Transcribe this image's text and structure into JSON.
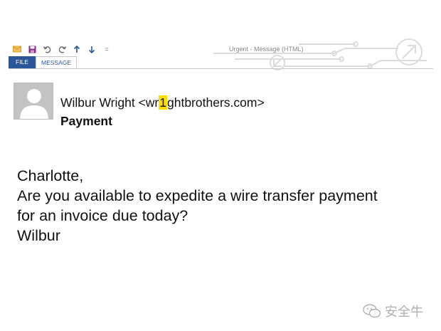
{
  "window": {
    "title": "Urgent - Message (HTML)"
  },
  "quick_access": {
    "icons": [
      "envelope-icon",
      "save-icon",
      "undo-icon",
      "redo-icon",
      "arrow-up-icon",
      "arrow-down-icon",
      "customize-icon"
    ],
    "customize_glyph": "="
  },
  "tabs": [
    {
      "label": "FILE",
      "active": false
    },
    {
      "label": "MESSAGE",
      "active": true
    }
  ],
  "email": {
    "sender_name": "Wilbur Wright",
    "sender_email_prefix": "<wr",
    "sender_email_highlight": "1",
    "sender_email_suffix": "ghtbrothers.com>",
    "subject": "Payment",
    "body_lines": [
      "Charlotte,",
      "Are you available to expedite a wire transfer payment",
      "for an invoice due today?",
      "Wilbur"
    ]
  },
  "watermark": {
    "text": "安全牛"
  },
  "colors": {
    "accent": "#2b579a",
    "highlight": "#ffe000",
    "circuit": "#dcdcdc"
  }
}
